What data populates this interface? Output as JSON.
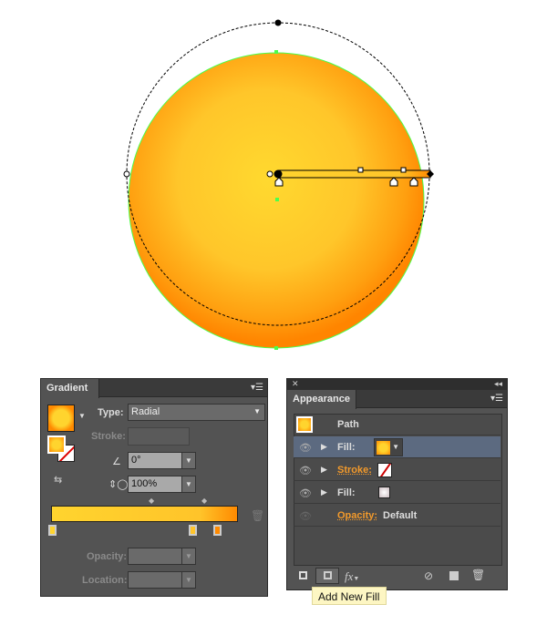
{
  "colors": {
    "gradient_start": "#ffd42e",
    "gradient_mid": "#ffc42a",
    "gradient_end": "#ff8a00",
    "selection": "#4cff4c"
  },
  "gradient_panel": {
    "title": "Gradient",
    "type_label": "Type:",
    "type_value": "Radial",
    "stroke_label": "Stroke:",
    "angle_value": "0°",
    "aspect_value": "100%",
    "opacity_label": "Opacity:",
    "location_label": "Location:",
    "icons": [
      "angle-icon",
      "aspect-ratio-icon",
      "trash-icon",
      "reverse-gradient-icon"
    ]
  },
  "appearance_panel": {
    "title": "Appearance",
    "rows": [
      {
        "label": "Path"
      },
      {
        "label": "Fill:"
      },
      {
        "label": "Stroke:"
      },
      {
        "label": "Fill:"
      },
      {
        "label": "Opacity:",
        "value": "Default"
      }
    ],
    "fx_label": "fx",
    "tooltip": "Add New Fill"
  }
}
